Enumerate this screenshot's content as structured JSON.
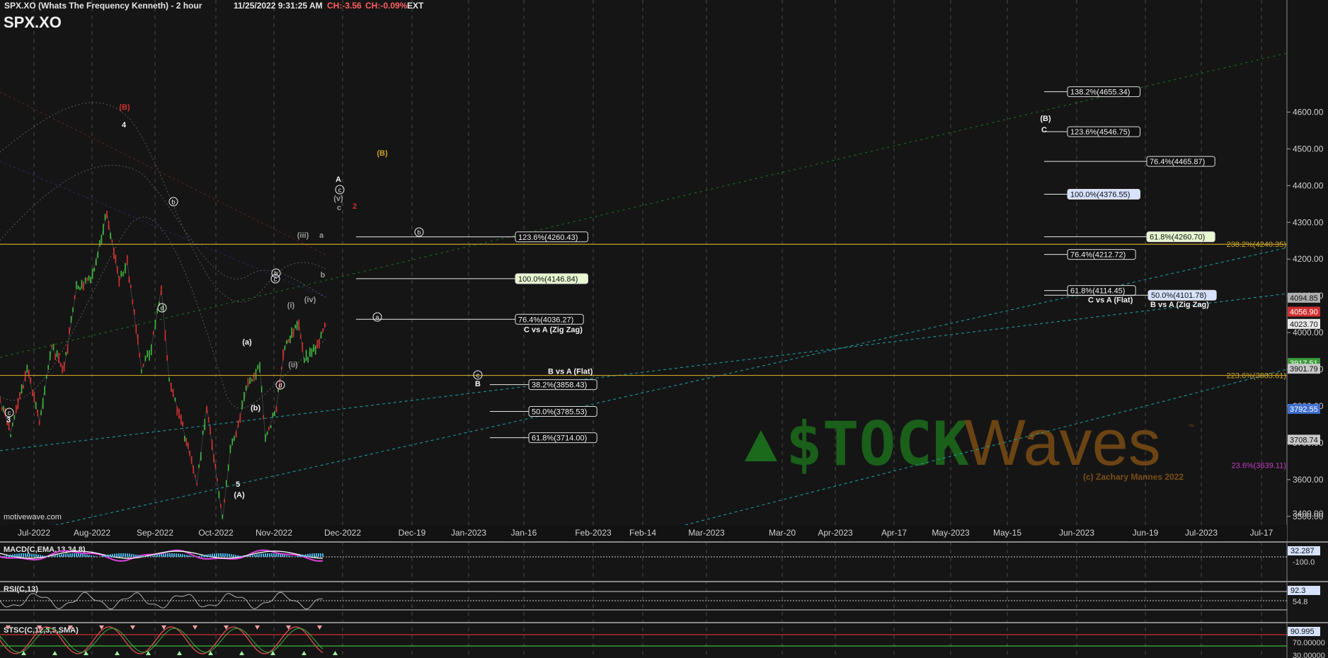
{
  "header": {
    "title": "SPX.XO (Whats The Frequency Kenneth) - 2 hour",
    "datetime": "11/25/2022 9:31:25 AM",
    "change": "CH:-3.56",
    "change_pct": "CH:-0.09%",
    "session": "EXT",
    "symbol": "SPX.XO"
  },
  "footer_source": "motivewave.com",
  "watermark": {
    "brand_left": "$TOCK",
    "brand_right": "Waves",
    "tm": "™",
    "copyright": "(c) Zachary Mannes 2022"
  },
  "colors": {
    "up": "#3dbb3d",
    "down": "#d93030",
    "gold": "#c9a227",
    "teal": "#1ea5a5",
    "wave_red": "#d03030",
    "magenta": "#c03ac0",
    "bg": "#151515"
  },
  "chart_data": {
    "type": "line",
    "title": "SPX.XO",
    "ylabel": "",
    "ylim": [
      3400,
      4700
    ],
    "x_ticks": [
      "Jul-2022",
      "Aug-2022",
      "Sep-2022",
      "Oct-2022",
      "Nov-2022",
      "Dec-2022",
      "Dec-19",
      "Jan-2023",
      "Jan-16",
      "Feb-2023",
      "Feb-14",
      "Mar-2023",
      "Mar-20",
      "Apr-2023",
      "Apr-17",
      "May-2023",
      "May-15",
      "Jun-2023",
      "Jun-19",
      "Jul-2023",
      "Jul-17"
    ],
    "y_ticks": [
      3500,
      3600,
      3700,
      3800,
      3900,
      4000,
      4100,
      4200,
      4300,
      4400,
      4500,
      4600
    ],
    "price_path": [
      {
        "x": "Jun-24-2022",
        "y": 3830
      },
      {
        "x": "Jun-30-2022",
        "y": 3730
      },
      {
        "x": "Jul-08-2022",
        "y": 3900
      },
      {
        "x": "Jul-14-2022",
        "y": 3760
      },
      {
        "x": "Jul-20-2022",
        "y": 3960
      },
      {
        "x": "Jul-26-2022",
        "y": 3900
      },
      {
        "x": "Aug-01-2022",
        "y": 4120
      },
      {
        "x": "Aug-08-2022",
        "y": 4140
      },
      {
        "x": "Aug-16-2022",
        "y": 4325
      },
      {
        "x": "Aug-22-2022",
        "y": 4140
      },
      {
        "x": "Aug-26-2022",
        "y": 4190
      },
      {
        "x": "Sep-02-2022",
        "y": 3900
      },
      {
        "x": "Sep-07-2022",
        "y": 3960
      },
      {
        "x": "Sep-12-2022",
        "y": 4120
      },
      {
        "x": "Sep-16-2022",
        "y": 3870
      },
      {
        "x": "Sep-22-2022",
        "y": 3760
      },
      {
        "x": "Sep-30-2022",
        "y": 3590
      },
      {
        "x": "Oct-05-2022",
        "y": 3800
      },
      {
        "x": "Oct-13-2022",
        "y": 3491
      },
      {
        "x": "Oct-17-2022",
        "y": 3680
      },
      {
        "x": "Oct-21-2022",
        "y": 3750
      },
      {
        "x": "Oct-26-2022",
        "y": 3860
      },
      {
        "x": "Nov-01-2022",
        "y": 3910
      },
      {
        "x": "Nov-03-2022",
        "y": 3710
      },
      {
        "x": "Nov-07-2022",
        "y": 3800
      },
      {
        "x": "Nov-10-2022",
        "y": 3960
      },
      {
        "x": "Nov-15-2022",
        "y": 4030
      },
      {
        "x": "Nov-17-2022",
        "y": 3920
      },
      {
        "x": "Nov-21-2022",
        "y": 3960
      },
      {
        "x": "Nov-25-2022",
        "y": 4024
      }
    ],
    "horizontal_lines": [
      {
        "y": 4240.35,
        "label": "238.2%(4240.35)",
        "color": "gold"
      },
      {
        "y": 3883.61,
        "label": "223.6%(3883.61)",
        "color": "gold"
      }
    ],
    "fib_left": [
      {
        "y": 4260.43,
        "label": "123.6%(4260.43)",
        "highlight": false
      },
      {
        "y": 4146.84,
        "label": "100.0%(4146.84)",
        "highlight": true
      },
      {
        "y": 4036.27,
        "label": "76.4%(4036.27)",
        "highlight": false,
        "sub": "C vs A (Zig Zag)"
      }
    ],
    "fib_b": [
      {
        "y": 3858.43,
        "label": "38.2%(3858.43)",
        "head": "B vs A (Flat)"
      },
      {
        "y": 3785.53,
        "label": "50.0%(3785.53)"
      },
      {
        "y": 3714.0,
        "label": "61.8%(3714.00)"
      }
    ],
    "fib_right": [
      {
        "y": 4655.34,
        "label": "138.2%(4655.34)",
        "style": "white"
      },
      {
        "y": 4546.75,
        "label": "123.6%(4546.75)",
        "style": "white"
      },
      {
        "y": 4465.87,
        "label": "76.4%(4465.87)",
        "style": "white"
      },
      {
        "y": 4376.55,
        "label": "100.0%(4376.55)",
        "style": "blue"
      },
      {
        "y": 4260.7,
        "label": "61.8%(4260.70)",
        "style": "green"
      },
      {
        "y": 4212.72,
        "label": "76.4%(4212.72)",
        "style": "white"
      },
      {
        "y": 4114.45,
        "label": "61.8%(4114.45)",
        "style": "white",
        "sub": "C vs A (Flat)"
      },
      {
        "y": 4101.78,
        "label": "50.0%(4101.78)",
        "style": "blue",
        "sub": "B vs A (Zig Zag)"
      }
    ],
    "other_labels": [
      {
        "y": 3639.11,
        "label": "23.6%(3639.11)",
        "color": "magenta"
      }
    ],
    "price_tags": [
      {
        "y": 4094.85,
        "label": "4094.85",
        "bg": "#b0b0b0"
      },
      {
        "y": 4056.9,
        "label": "4056.90",
        "bg": "#d03030"
      },
      {
        "y": 4023.7,
        "label": "4023.70",
        "bg": "#e8e8e8"
      },
      {
        "y": 3917.51,
        "label": "3917.51",
        "bg": "#3a9a3a"
      },
      {
        "y": 3901.79,
        "label": "3901.79",
        "bg": "#c8c8c8"
      },
      {
        "y": 3792.55,
        "label": "3792.55",
        "bg": "#3f6fcf"
      },
      {
        "y": 3708.74,
        "label": "3708.74",
        "bg": "#c8c8c8"
      }
    ],
    "wave_labels": [
      {
        "t": "(B)",
        "c": "red"
      },
      {
        "t": "4",
        "c": "white"
      },
      {
        "t": "b",
        "c": "circle"
      },
      {
        "t": "d",
        "c": "circle"
      },
      {
        "t": "3",
        "c": "white"
      },
      {
        "t": "c",
        "c": "circle"
      },
      {
        "t": "5",
        "c": "white"
      },
      {
        "t": "(A)",
        "c": "white"
      },
      {
        "t": "(a)",
        "c": "white"
      },
      {
        "t": "(b)",
        "c": "white"
      },
      {
        "t": "d",
        "c": "circle"
      },
      {
        "t": "c",
        "c": "circle"
      },
      {
        "t": "(i)",
        "c": "grey"
      },
      {
        "t": "(ii)",
        "c": "grey"
      },
      {
        "t": "(iii)",
        "c": "grey"
      },
      {
        "t": "(iv)",
        "c": "grey"
      },
      {
        "t": "b",
        "c": "circle"
      },
      {
        "t": "a",
        "c": "grey"
      },
      {
        "t": "b",
        "c": "grey"
      },
      {
        "t": "(v)",
        "c": "grey"
      },
      {
        "t": "c",
        "c": "grey"
      },
      {
        "t": "2",
        "c": "red"
      },
      {
        "t": "A",
        "c": "white"
      },
      {
        "t": "c",
        "c": "circle"
      },
      {
        "t": "(B)",
        "c": "gold"
      },
      {
        "t": "b",
        "c": "circle"
      },
      {
        "t": "a",
        "c": "circle"
      },
      {
        "t": "c",
        "c": "circle"
      },
      {
        "t": "B",
        "c": "white"
      },
      {
        "t": "(B)",
        "c": "white"
      },
      {
        "t": "C",
        "c": "white"
      }
    ]
  },
  "indicators": [
    {
      "name": "MACD(C,EMA,13,34,8)",
      "value": "32.287",
      "ticks": [
        "-100.0"
      ]
    },
    {
      "name": "RSI(C,13)",
      "value": "92.3",
      "ticks": [
        "54.8"
      ]
    },
    {
      "name": "STSC(C,12,3,5,SMA)",
      "value": "90.995",
      "ticks": [
        "70.00000",
        "30.00000"
      ]
    }
  ]
}
